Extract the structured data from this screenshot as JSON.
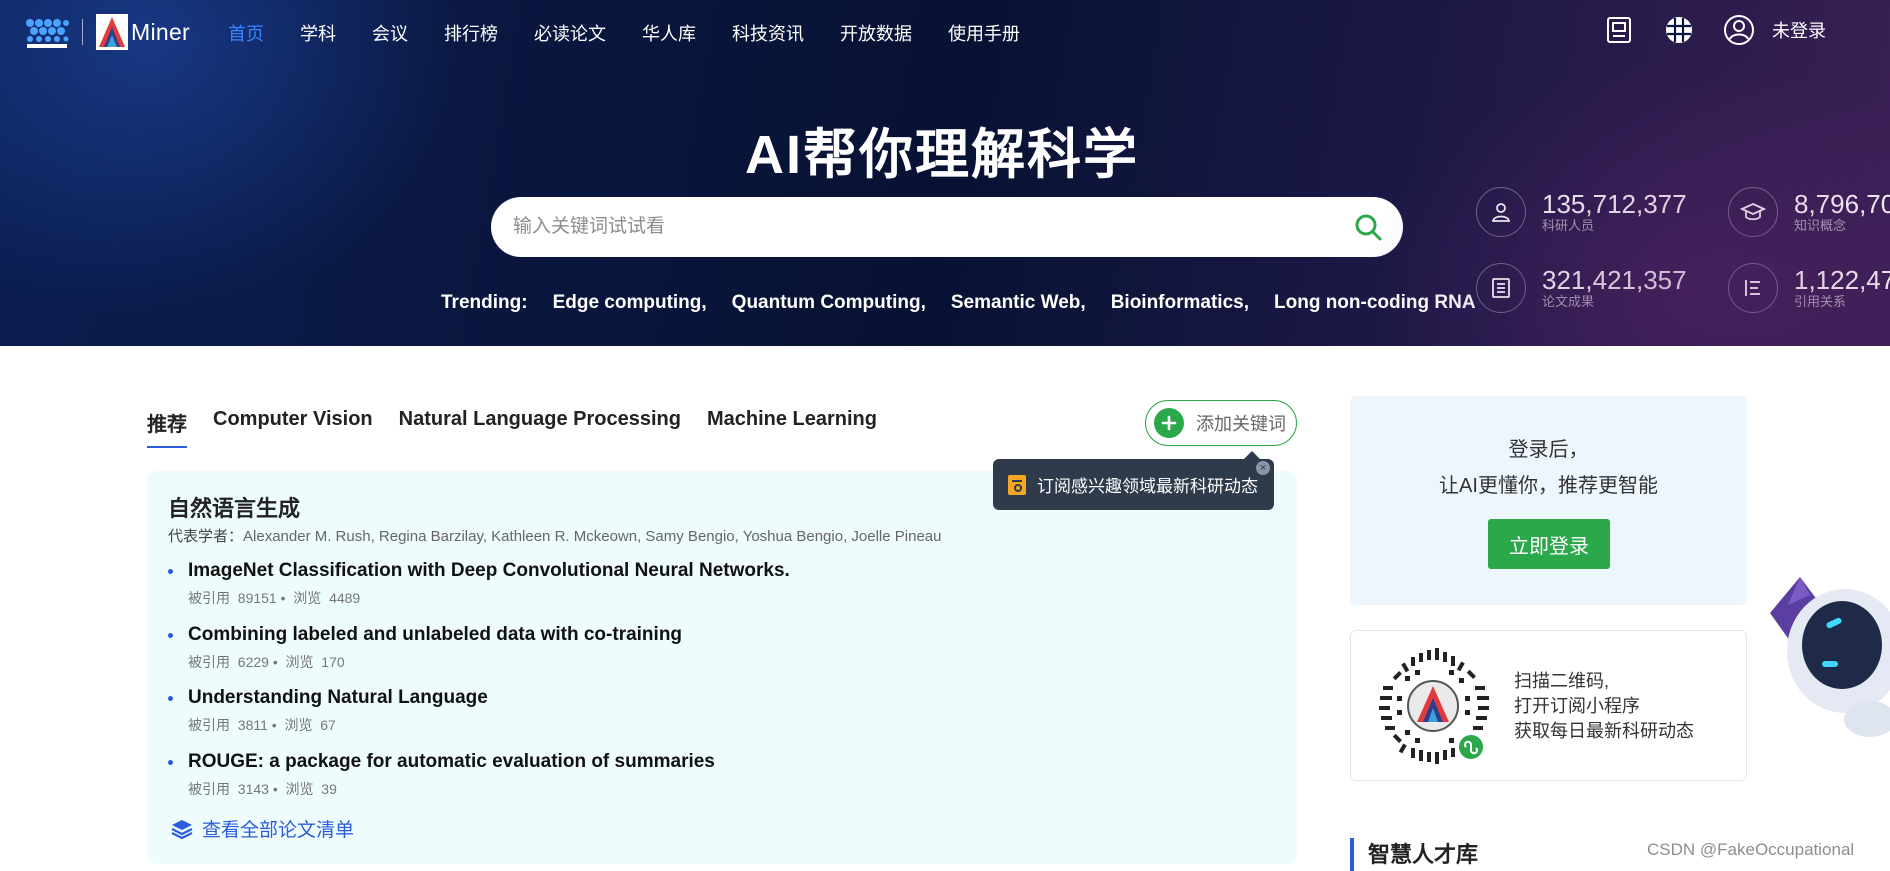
{
  "nav": {
    "logo_text": "Miner",
    "links": [
      "首页",
      "学科",
      "会议",
      "排行榜",
      "必读论文",
      "华人库",
      "科技资讯",
      "开放数据",
      "使用手册"
    ],
    "active_index": 0,
    "login_label": "未登录",
    "icons": [
      "app-icon",
      "grid-icon",
      "user-icon"
    ]
  },
  "hero": {
    "title": "AI帮你理解科学",
    "search_placeholder": "输入关键词试试看",
    "trending_label": "Trending:",
    "trending": [
      "Edge computing,",
      "Quantum Computing,",
      "Semantic Web,",
      "Bioinformatics,",
      "Long non-coding RNA"
    ],
    "stats": [
      {
        "value": "135,712,377",
        "label": "科研人员",
        "icon": "person-icon"
      },
      {
        "value": "8,796,70",
        "label": "知识概念",
        "icon": "graduation-cap-icon"
      },
      {
        "value": "321,421,357",
        "label": "论文成果",
        "icon": "paper-icon"
      },
      {
        "value": "1,122,47",
        "label": "引用关系",
        "icon": "citation-icon"
      }
    ]
  },
  "tabs": [
    "推荐",
    "Computer Vision",
    "Natural Language Processing",
    "Machine Learning"
  ],
  "add_keyword": "添加关键词",
  "tooltip": "订阅感兴趣领域最新科研动态",
  "topic": {
    "title": "自然语言生成",
    "scholars_label": "代表学者：",
    "scholars": "Alexander M. Rush, Regina Barzilay, Kathleen R. Mckeown, Samy Bengio, Yoshua Bengio, Joelle Pineau",
    "papers": [
      {
        "title": "ImageNet Classification with Deep Convolutional Neural Networks.",
        "cited_label": "被引用",
        "cited": "89151",
        "views_label": "浏览",
        "views": "4489"
      },
      {
        "title": "Combining labeled and unlabeled data with co-training",
        "cited_label": "被引用",
        "cited": "6229",
        "views_label": "浏览",
        "views": "170"
      },
      {
        "title": "Understanding Natural Language",
        "cited_label": "被引用",
        "cited": "3811",
        "views_label": "浏览",
        "views": "67"
      },
      {
        "title": "ROUGE: a package for automatic evaluation of summaries",
        "cited_label": "被引用",
        "cited": "3143",
        "views_label": "浏览",
        "views": "39"
      }
    ],
    "view_all": "查看全部论文清单"
  },
  "login_card": {
    "line1": "登录后，",
    "line2": "让AI更懂你，推荐更智能",
    "button": "立即登录"
  },
  "qr_card": {
    "lines": [
      "扫描二维码,",
      "打开订阅小程序",
      "获取每日最新科研动态"
    ]
  },
  "talent_title": "智慧人才库",
  "watermark": "CSDN @FakeOccupational",
  "colors": {
    "accent_blue": "#2b5cd9",
    "nav_active": "#3b82ff",
    "green": "#2aa84a",
    "card_bg": "#eefcfd",
    "tooltip_bg": "#2f3a4a"
  }
}
